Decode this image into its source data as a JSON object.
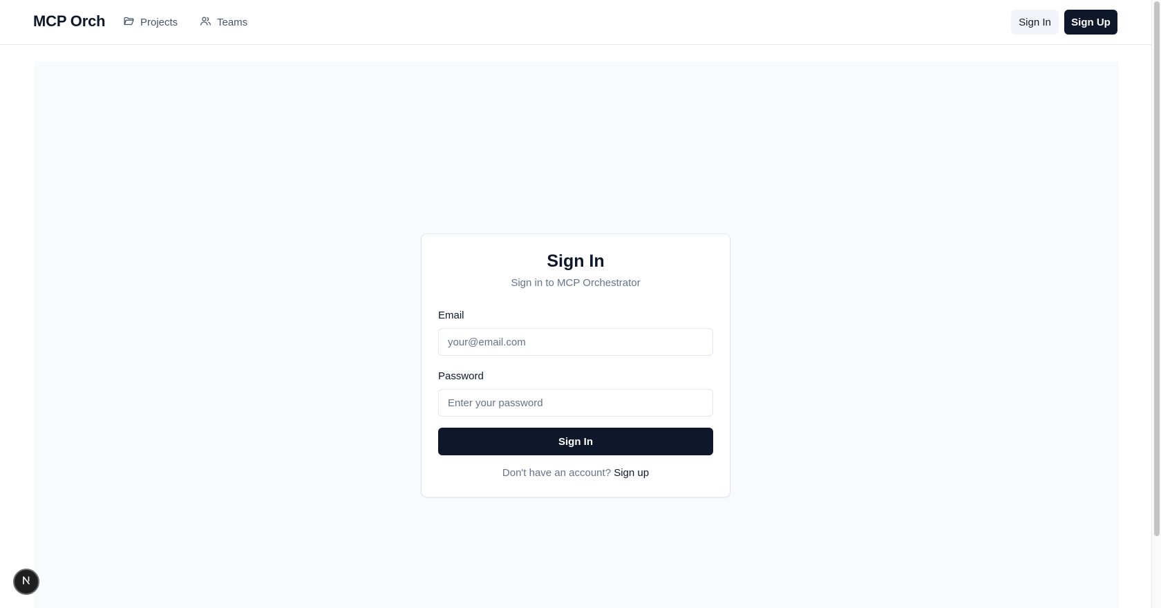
{
  "header": {
    "brand": "MCP Orch",
    "nav": [
      {
        "label": "Projects",
        "icon": "folder-icon"
      },
      {
        "label": "Teams",
        "icon": "users-icon"
      }
    ],
    "sign_in_label": "Sign In",
    "sign_up_label": "Sign Up"
  },
  "card": {
    "title": "Sign In",
    "subtitle": "Sign in to MCP Orchestrator",
    "email_label": "Email",
    "email_placeholder": "your@email.com",
    "email_value": "",
    "password_label": "Password",
    "password_placeholder": "Enter your password",
    "password_value": "",
    "submit_label": "Sign In",
    "footer_prompt": "Don't have an account?",
    "footer_link": "Sign up"
  },
  "dev_badge": {
    "icon": "nextjs-icon",
    "letter": "N"
  },
  "colors": {
    "primary": "#0f172a",
    "muted_text": "#64748b",
    "panel_bg": "#f8fafc",
    "border": "#e2e8f0"
  }
}
